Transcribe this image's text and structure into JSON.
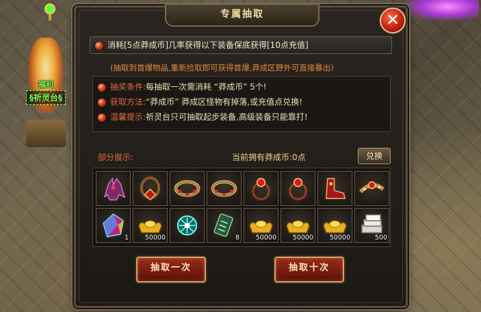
{
  "window": {
    "title": "专属抽取",
    "close_symbol": "✕"
  },
  "shrine": {
    "line1": "福利",
    "line2": "祈灵台"
  },
  "notice": {
    "text": "消耗[5点莽成币]几率获得以下装备保底获得[10点充值]",
    "sub_text": "(抽取到首爆物品,重新捡取即可获得首爆,莽成区野外可直接暴出)"
  },
  "rules": [
    {
      "key": "抽奖条件:",
      "value": "每抽取一次需消耗 “莽成币” 5个!"
    },
    {
      "key": "获取方法:",
      "value": "“莽成币” 莽成区怪物有掉落,或充值点兑换!"
    },
    {
      "key": "温馨提示:",
      "value": "祈灵台只可抽取起步装备,高级装备只能靠打!"
    }
  ],
  "display": {
    "partial_label": "部分展示:",
    "coins_label": "当前拥有莽成币:0点",
    "exchange_button": "兑换"
  },
  "items": [
    {
      "icon": "helmet-icon",
      "qty": ""
    },
    {
      "icon": "necklace-icon",
      "qty": ""
    },
    {
      "icon": "bracelet-icon",
      "qty": ""
    },
    {
      "icon": "bracelet-icon",
      "qty": ""
    },
    {
      "icon": "ring-icon",
      "qty": ""
    },
    {
      "icon": "ring-icon",
      "qty": ""
    },
    {
      "icon": "boots-icon",
      "qty": ""
    },
    {
      "icon": "belt-icon",
      "qty": ""
    },
    {
      "icon": "gem-icon",
      "qty": "1"
    },
    {
      "icon": "gold-ingot-icon",
      "qty": "50000"
    },
    {
      "icon": "orb-icon",
      "qty": ""
    },
    {
      "icon": "scroll-icon",
      "qty": "8"
    },
    {
      "icon": "gold-ingot-icon",
      "qty": "50000"
    },
    {
      "icon": "gold-ingot-icon",
      "qty": "50000"
    },
    {
      "icon": "gold-ingot-icon",
      "qty": "50000"
    },
    {
      "icon": "silver-stack-icon",
      "qty": "500"
    }
  ],
  "buttons": {
    "draw_once": "抽取一次",
    "draw_ten": "抽取十次"
  }
}
